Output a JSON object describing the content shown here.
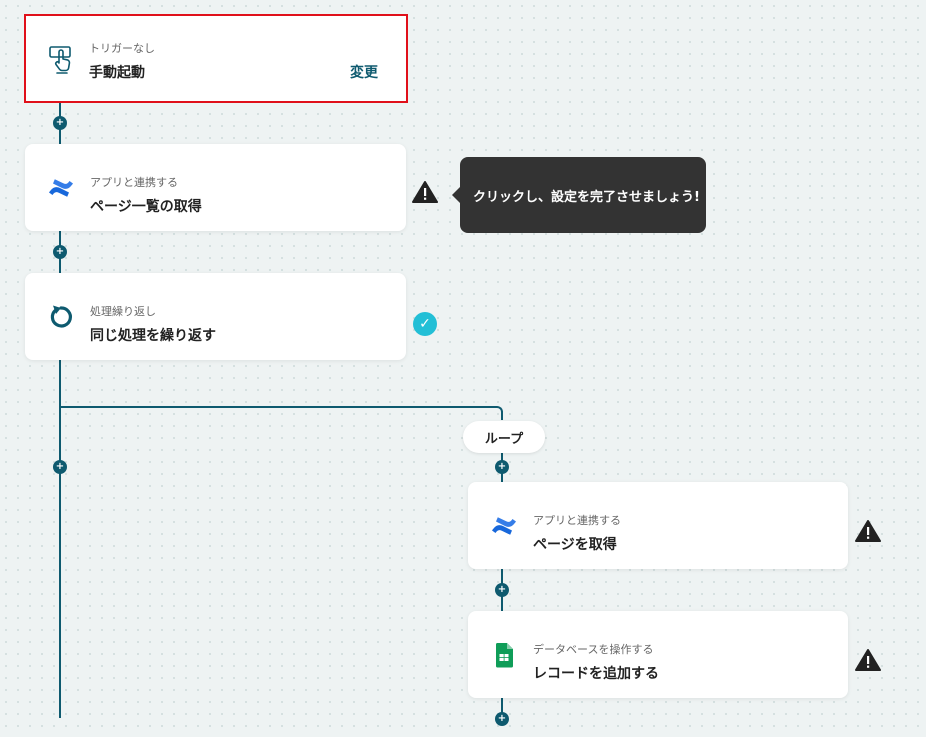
{
  "trigger": {
    "subtitle": "トリガーなし",
    "title": "手動起動",
    "action": "変更"
  },
  "steps": [
    {
      "subtitle": "アプリと連携する",
      "title": "ページ一覧の取得",
      "icon": "confluence-icon"
    },
    {
      "subtitle": "処理繰り返し",
      "title": "同じ処理を繰り返す",
      "icon": "loop-icon"
    }
  ],
  "tooltip": "クリックし、設定を完了させましょう!",
  "loop_label": "ループ",
  "loop_steps": [
    {
      "subtitle": "アプリと連携する",
      "title": "ページを取得",
      "icon": "confluence-icon"
    },
    {
      "subtitle": "データベースを操作する",
      "title": "レコードを追加する",
      "icon": "google-sheets-icon"
    }
  ],
  "colors": {
    "line": "#0e5a6f",
    "selected_border": "#e0101a",
    "check": "#22bfd6",
    "tooltip_bg": "#333333",
    "confluence_blue": "#1868db",
    "sheets_green": "#0f9d58"
  }
}
